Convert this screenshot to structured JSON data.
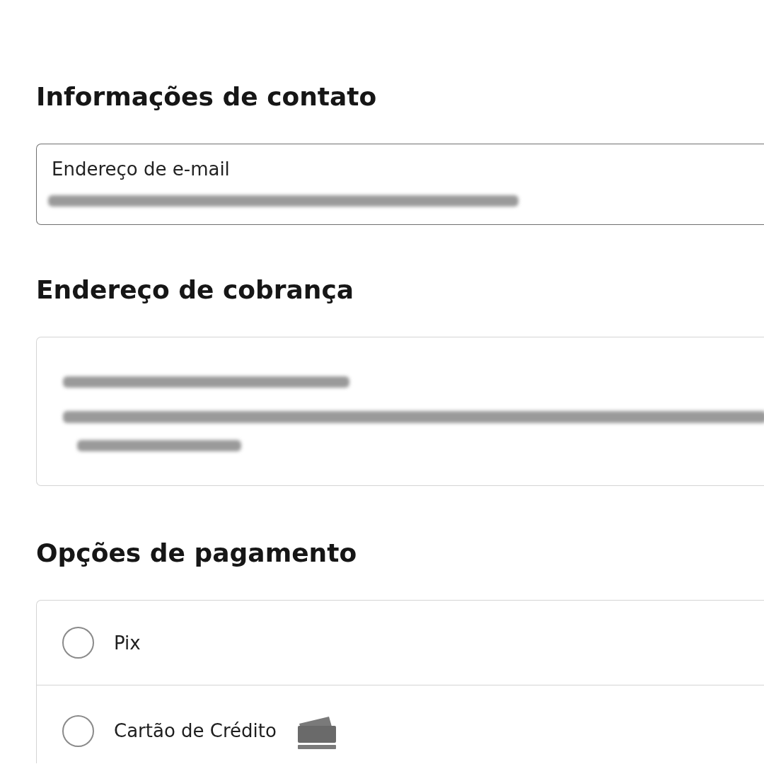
{
  "contact": {
    "title": "Informações de contato",
    "email_field": {
      "label": "Endereço de e-mail",
      "redacted": true
    }
  },
  "billing": {
    "title": "Endereço de cobrança",
    "address": {
      "redacted": true
    }
  },
  "payment": {
    "title": "Opções de pagamento",
    "options": [
      {
        "label": "Pix",
        "selected": false,
        "kind": "plain"
      },
      {
        "label": "Cartão de Crédito",
        "selected": false,
        "kind": "with_icon"
      }
    ]
  }
}
